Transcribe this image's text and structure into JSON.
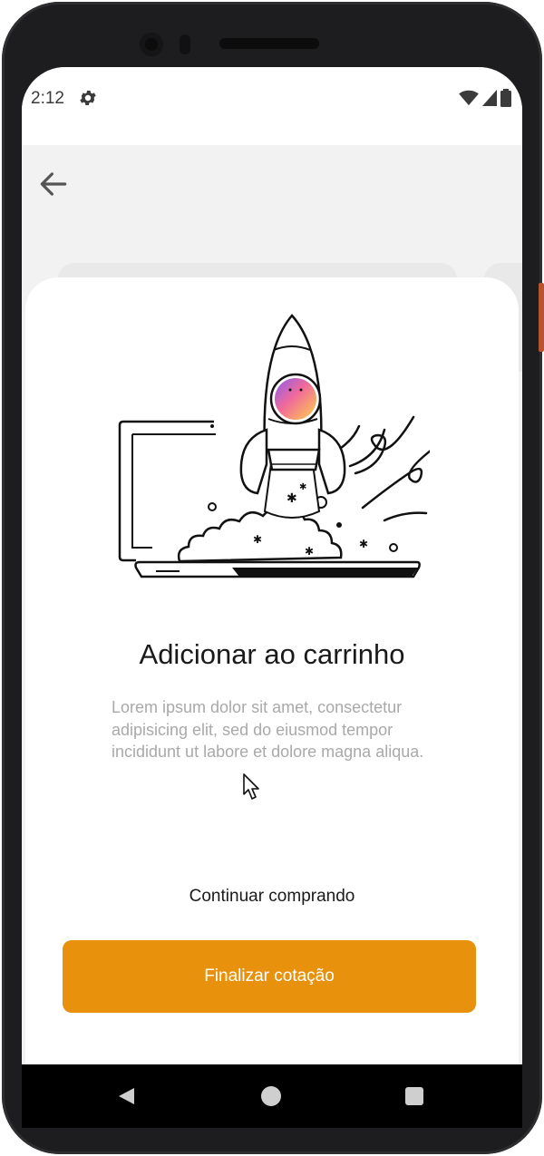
{
  "status_bar": {
    "time": "2:12",
    "icons": [
      "gear-icon",
      "wifi-icon",
      "signal-icon",
      "battery-icon"
    ]
  },
  "app_bar": {
    "back_icon": "arrow-left-icon"
  },
  "dialog": {
    "title": "Adicionar ao carrinho",
    "description": "Lorem ipsum dolor sit amet, consectetur adipisicing elit, sed do eiusmod tempor incididunt ut labore et dolore magna aliqua.",
    "secondary_action": "Continuar comprando",
    "primary_action": "Finalizar cotação",
    "illustration": "rocket-launch-from-laptop"
  },
  "nav_bar": {
    "icons": [
      "nav-back-icon",
      "nav-home-icon",
      "nav-recents-icon"
    ]
  },
  "colors": {
    "accent": "#e8910c",
    "text_primary": "#1a1a1a",
    "text_secondary": "#a9a9a9"
  }
}
